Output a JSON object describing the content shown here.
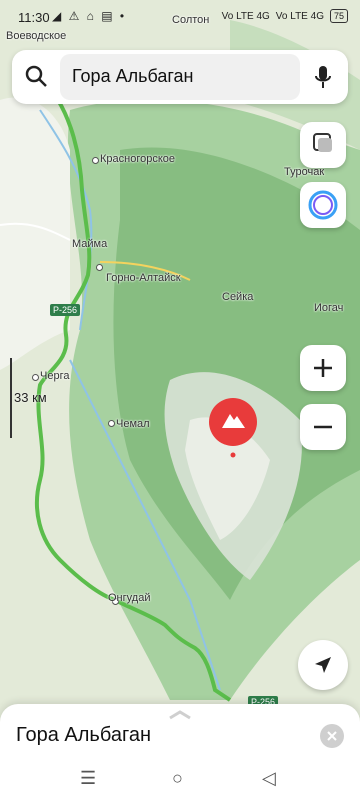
{
  "status_bar": {
    "time": "11:30",
    "left_icons": "◢ ⚠ ⌂ ▤ •",
    "network_1": "Vo LTE 4G",
    "network_2": "Vo LTE 4G",
    "battery": "75"
  },
  "search": {
    "query": "Гора Альбаган",
    "icon_left": "search-icon",
    "icon_right": "microphone-icon"
  },
  "map": {
    "places": [
      {
        "name": "Воеводское"
      },
      {
        "name": "Солтон"
      },
      {
        "name": "Красногорское"
      },
      {
        "name": "Турочак"
      },
      {
        "name": "Майма"
      },
      {
        "name": "Горно-Алтайск"
      },
      {
        "name": "Сейка"
      },
      {
        "name": "Иогач"
      },
      {
        "name": "Черга"
      },
      {
        "name": "Чемал"
      },
      {
        "name": "Онгудай"
      }
    ],
    "road_badges": [
      "Р-256",
      "Р-256"
    ],
    "scale": "33 км",
    "marker": "mountain-pin"
  },
  "controls": {
    "layers": "layers-icon",
    "alice": "alice-assistant-icon",
    "zoom_in": "+",
    "zoom_out": "−",
    "locate": "navigation-arrow-icon"
  },
  "sheet": {
    "title": "Гора Альбаган"
  },
  "nav_bar": {
    "menu": "☰",
    "home": "○",
    "back": "◁"
  }
}
